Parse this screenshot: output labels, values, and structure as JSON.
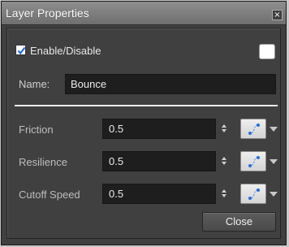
{
  "window": {
    "title": "Layer Properties",
    "close_glyph": "×"
  },
  "enable": {
    "label": "Enable/Disable",
    "checked": true,
    "swatch_color": "#ffffff"
  },
  "name": {
    "label": "Name:",
    "value": "Bounce"
  },
  "rows": [
    {
      "label": "Friction",
      "value": "0.5",
      "icon": "function-curve-icon"
    },
    {
      "label": "Resilience",
      "value": "0.5",
      "icon": "function-curve-icon"
    },
    {
      "label": "Cutoff Speed",
      "value": "0.5",
      "icon": "function-curve-icon"
    }
  ],
  "footer": {
    "close_label": "Close"
  },
  "colors": {
    "background": "#404040",
    "field": "#1e1e1e",
    "accent": "#2a6fd6"
  }
}
